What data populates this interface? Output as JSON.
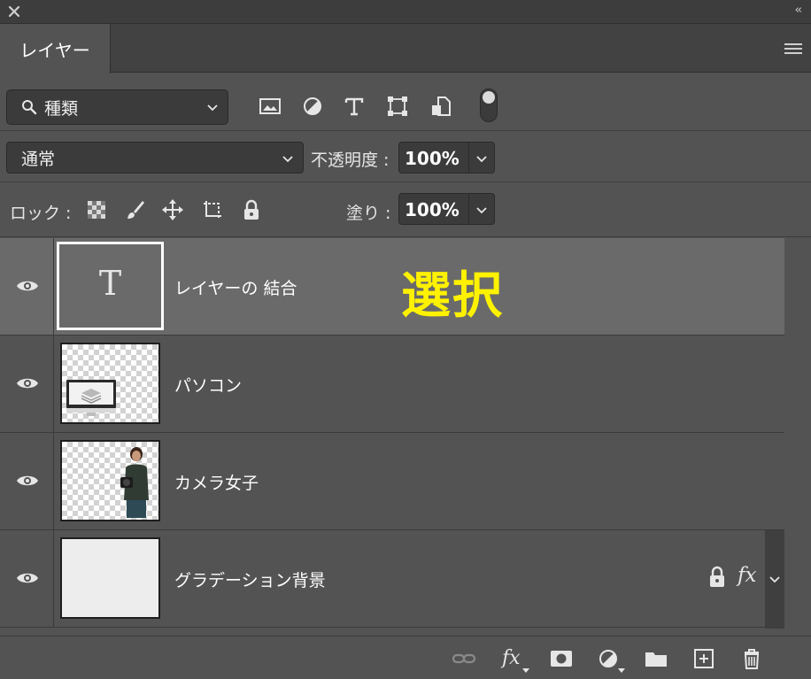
{
  "panel": {
    "tab_label": "レイヤー",
    "close_icon": "close-icon",
    "collapse_label": "‹‹"
  },
  "filter": {
    "kind_label": "種類",
    "icons": [
      "image-filter-icon",
      "adjustment-filter-icon",
      "type-filter-icon",
      "shape-filter-icon",
      "smart-object-filter-icon"
    ]
  },
  "blend": {
    "mode": "通常",
    "opacity_label": "不透明度 :",
    "opacity_value": "100%"
  },
  "lock": {
    "label": "ロック :",
    "fill_label": "塗り :",
    "fill_value": "100%"
  },
  "layers": [
    {
      "name": "レイヤーの 結合",
      "selected": true,
      "type_glyph": "T"
    },
    {
      "name": "パソコン",
      "selected": false
    },
    {
      "name": "カメラ女子",
      "selected": false
    },
    {
      "name": "グラデーション背景",
      "selected": false,
      "locked": true,
      "has_fx": true,
      "fx_label": "fx"
    }
  ],
  "annotation": "選択",
  "bottom": {
    "fx_label": "fx"
  },
  "colors": {
    "panel_bg": "#535353",
    "selected_row": "#6a6a6a",
    "annotation": "#fff200"
  }
}
